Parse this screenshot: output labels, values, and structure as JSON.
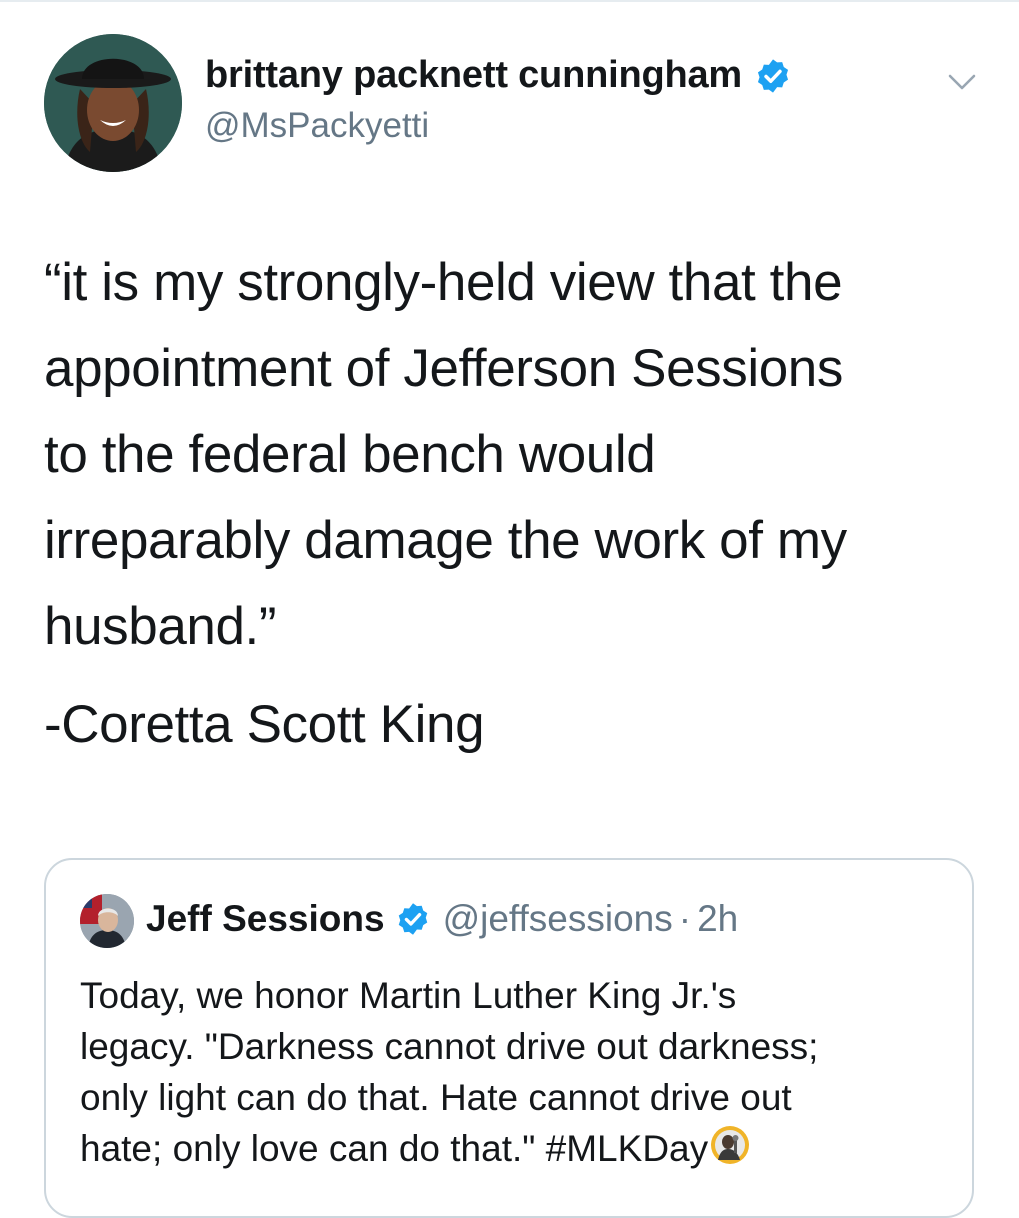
{
  "author": {
    "display_name": "brittany packnett cunningham",
    "handle": "@MsPackyetti",
    "avatar_icon": "profile-photo-avatar",
    "verified_icon": "verified-badge-icon"
  },
  "menu": {
    "icon": "chevron-down-icon"
  },
  "tweet": {
    "lines": [
      "“it is my strongly-held view that the",
      "appointment of Jefferson Sessions",
      "to the federal bench would",
      "irreparably damage the work of my",
      "husband.”"
    ],
    "attribution": "-Coretta Scott King"
  },
  "quoted_tweet": {
    "display_name": "Jeff Sessions",
    "handle": "@jeffsessions",
    "separator": "·",
    "time": "2h",
    "lines": [
      "Today, we honor Martin Luther King Jr.'s",
      "legacy. \"Darkness cannot drive out darkness;",
      "only light can do that. Hate cannot drive out",
      "hate; only love can do that.\" #MLKDay"
    ],
    "trailing_emoji_icon": "mlk-hashflag-emoji-icon"
  },
  "colors": {
    "text": "#14171a",
    "secondary": "#657786",
    "verified_blue": "#1da1f2",
    "border": "#ccd6dd"
  }
}
